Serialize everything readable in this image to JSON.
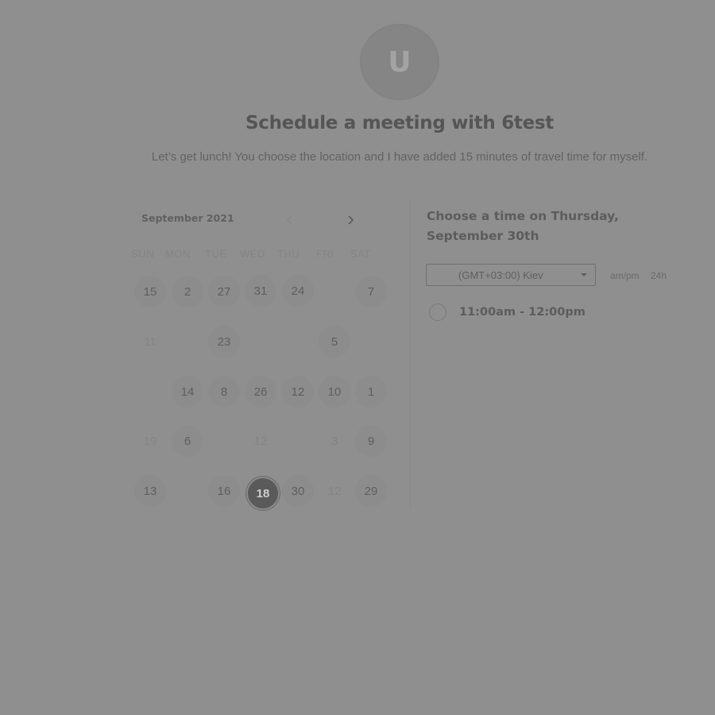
{
  "header": {
    "avatar_letter": "U",
    "title": "Schedule a meeting with 6test",
    "description": "Let’s get lunch! You choose the location and I have added 15 minutes of travel time for myself."
  },
  "calendar": {
    "month_label": "September 2021",
    "weekdays": [
      "SUN",
      "MON",
      "TUE",
      "WED",
      "THU",
      "FRI",
      "SAT"
    ],
    "weeks": [
      [
        "15",
        "2",
        "27",
        "31",
        "24",
        "",
        "7"
      ],
      [
        "11",
        "",
        "23",
        "",
        "",
        "5",
        ""
      ],
      [
        "",
        "14",
        "8",
        "26",
        "12",
        "10",
        "1"
      ],
      [
        "19",
        "6",
        "",
        "12",
        "",
        "3",
        "9"
      ],
      [
        "13",
        "",
        "16",
        "18",
        "30",
        "12",
        "29"
      ]
    ],
    "selected_day": "18"
  },
  "time_panel": {
    "heading_line1": "Choose a time on Thursday,",
    "heading_line2": "September 30th",
    "timezone": "(GMT+03:00) Kiev",
    "format_ampm": "am/pm",
    "format_24h": "24h",
    "slots": [
      {
        "label": "11:00am - 12:00pm"
      }
    ]
  },
  "colors": {
    "overlay": "#8f8f8f",
    "selected_day": "#5a5a5a"
  }
}
